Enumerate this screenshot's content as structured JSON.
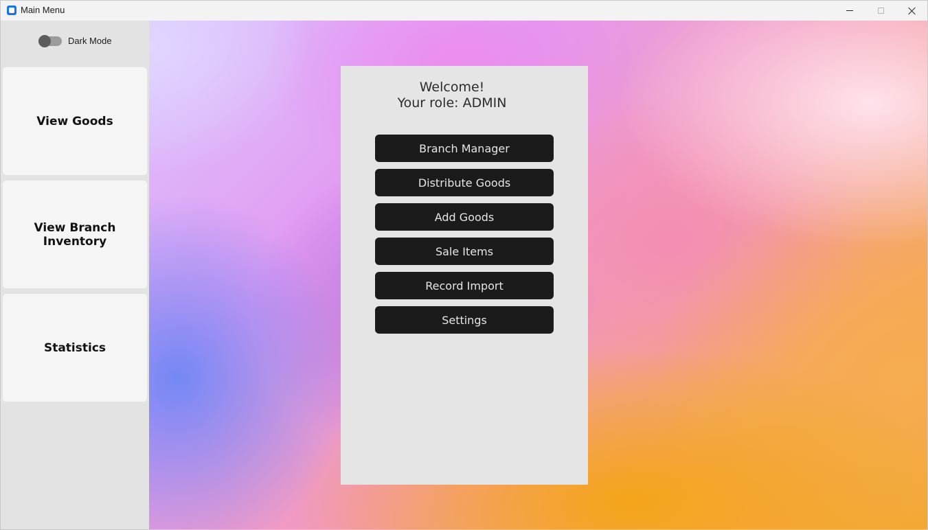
{
  "window": {
    "title": "Main Menu",
    "app_icon": "app-icon",
    "controls": [
      "minimize-icon",
      "maximize-icon",
      "close-icon"
    ]
  },
  "sidebar": {
    "dark_mode_label": "Dark Mode",
    "dark_mode_on": false,
    "items": [
      {
        "label": "View Goods"
      },
      {
        "label": "View Branch Inventory"
      },
      {
        "label": "Statistics"
      }
    ]
  },
  "panel": {
    "welcome": "Welcome!",
    "role_line": "Your role: ADMIN",
    "buttons": [
      {
        "label": "Branch Manager"
      },
      {
        "label": "Distribute Goods"
      },
      {
        "label": "Add Goods"
      },
      {
        "label": "Sale Items"
      },
      {
        "label": "Record Import"
      },
      {
        "label": "Settings"
      }
    ]
  },
  "colors": {
    "button_bg": "#1b1b1b",
    "button_text": "#e6e6e6",
    "panel_bg": "#e5e5e5",
    "sidebar_bg": "#e3e3e3",
    "card_bg": "#f5f5f5"
  }
}
